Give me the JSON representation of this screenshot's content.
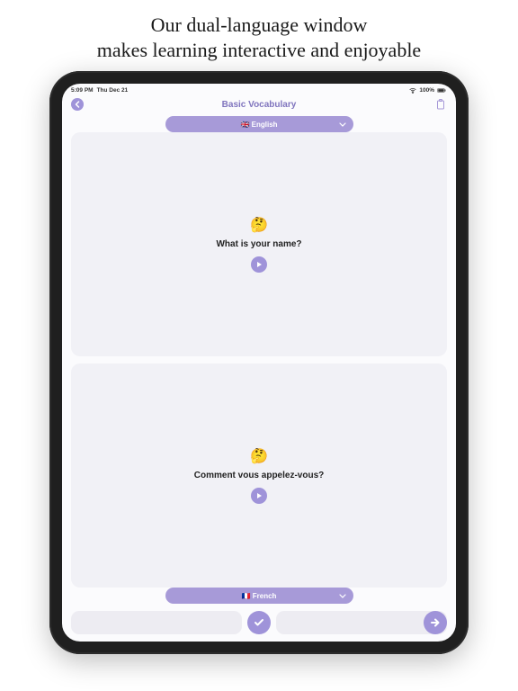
{
  "marketing": {
    "line1": "Our dual-language window",
    "line2": "makes learning interactive and enjoyable"
  },
  "status": {
    "time": "5:09 PM",
    "date": "Thu Dec 21",
    "battery": "100%"
  },
  "nav": {
    "title": "Basic Vocabulary"
  },
  "cards": {
    "top_lang_label": "🇬🇧 English",
    "top_emoji": "🤔",
    "top_text": "What is your name?",
    "bottom_lang_label": "🇫🇷 French",
    "bottom_emoji": "🤔",
    "bottom_text": "Comment vous appelez-vous?"
  },
  "colors": {
    "accent": "#9f93d9",
    "card_bg": "#f1f1f6"
  }
}
